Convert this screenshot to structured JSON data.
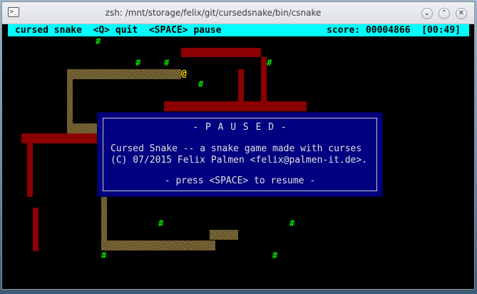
{
  "window": {
    "title": "zsh: /mnt/storage/felix/git/cursedsnake/bin/csnake",
    "icon": "terminal-icon",
    "buttons": [
      "minimize-icon",
      "maximize-icon",
      "close-icon"
    ],
    "button_glyphs": {
      "minimize": "⌄",
      "maximize": "⌃",
      "close": "✕"
    }
  },
  "status": {
    "left": "cursed snake  <Q> quit  <SPACE> pause",
    "right": "score: 00004866  [00:49]"
  },
  "board": {
    "head_char": "@",
    "food_char": "#"
  },
  "dialog": {
    "title": "- P A U S E D -",
    "line1": "Cursed Snake -- a snake game made with curses",
    "line2": "(C) 07/2015 Felix Palmen <felix@palmen-it.de>.",
    "resume": "- press <SPACE> to resume -"
  },
  "colors": {
    "status_bg": "#00ffff",
    "wall": "#8b0000",
    "food": "#00e600",
    "head": "#ffd700",
    "dialog_bg": "#000080"
  }
}
